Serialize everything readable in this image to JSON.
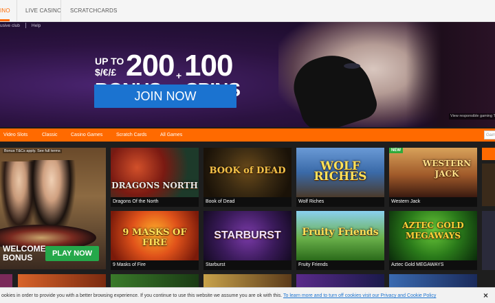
{
  "topnav": {
    "tabs": [
      {
        "label": "INO",
        "active": true
      },
      {
        "label": "LIVE CASINO",
        "active": false
      },
      {
        "label": "SCRATCHCARDS",
        "active": false
      }
    ]
  },
  "hero": {
    "sublinks": [
      "usive club",
      "Help"
    ],
    "promo": {
      "upto": "UP TO",
      "currency": "$/€/£",
      "bonus_amount": "200",
      "plus": "+",
      "spins_amount": "100",
      "bonus_word": "BONUS",
      "spins_word": "SPINS"
    },
    "cta_label": "JOIN NOW",
    "terms_link": "View responsible gaming T&C"
  },
  "categories": [
    "Video Slots",
    "Classic",
    "Casino Games",
    "Scratch Cards",
    "All Games"
  ],
  "search": {
    "placeholder": "Gam"
  },
  "welcome_ad": {
    "note": "Bonus T&Cs apply. See full terms",
    "line1": "WELCOME",
    "line2": "BONUS",
    "cta": "PLAY NOW"
  },
  "games": [
    {
      "name": "Dragons Of the North",
      "logo": "DRAGONS NORTH",
      "is_new": false
    },
    {
      "name": "Book of Dead",
      "logo": "BOOK of DEAD",
      "is_new": false
    },
    {
      "name": "Wolf Riches",
      "logo": "WOLF RICHES",
      "is_new": false
    },
    {
      "name": "Western Jack",
      "logo": "WESTERN JACK",
      "is_new": true
    },
    {
      "name": "9 Masks of Fire",
      "logo": "9 MASKS OF FIRE",
      "is_new": false
    },
    {
      "name": "Starburst",
      "logo": "STARBURST",
      "is_new": false
    },
    {
      "name": "Fruity Friends",
      "logo": "Fruity Friends",
      "is_new": false
    },
    {
      "name": "Aztec Gold MEGAWAYS",
      "logo": "AZTEC GOLD MEGAWAYS",
      "is_new": false
    }
  ],
  "new_badge": "NEW",
  "cookie": {
    "message": "ookies in order to provide you with a better browsing experience. If you continue to use this website we assume you are ok with this.",
    "link": "To learn more and to turn off cookies visit our Privacy and Cookie Policy",
    "close": "×"
  },
  "colors": {
    "accent": "#ff6a00",
    "cta_blue": "#1b73d0",
    "play_green": "#25a84a",
    "new_green": "#2eaa3a"
  }
}
